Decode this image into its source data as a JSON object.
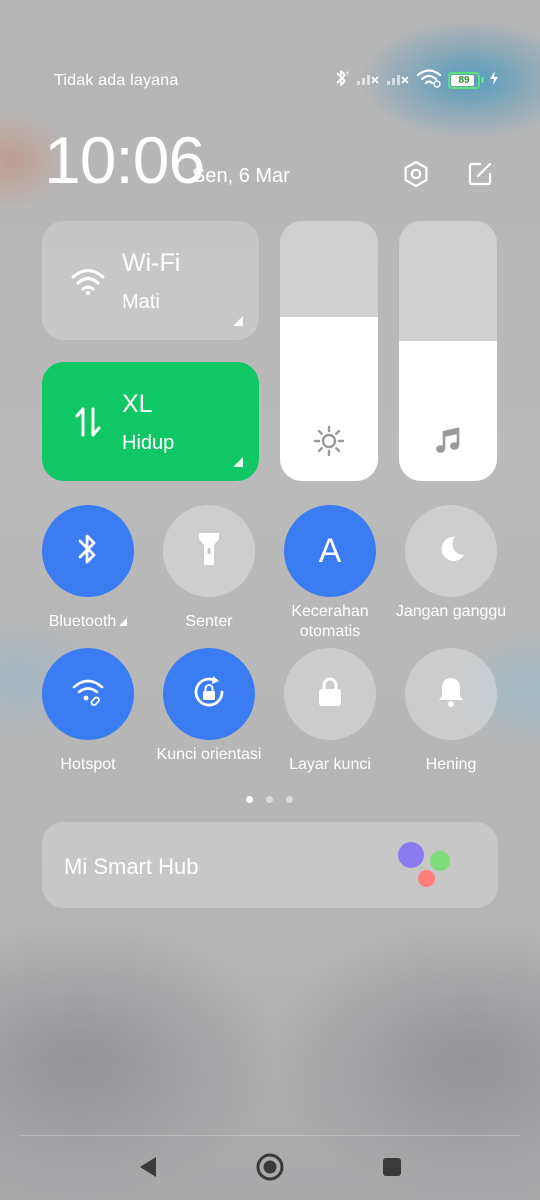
{
  "status_bar": {
    "carrier": "Tidak ada layana",
    "battery": "89",
    "battery_level": 0.89,
    "icons": [
      "bluetooth-icon",
      "signal-no-service-icon",
      "signal-no-service-icon",
      "wifi-icon",
      "battery-icon",
      "charging-icon"
    ]
  },
  "header": {
    "time": "10:06",
    "date": "Sen, 6 Mar",
    "icons": [
      "settings-icon",
      "edit-icon"
    ]
  },
  "tiles": {
    "wifi": {
      "title": "Wi-Fi",
      "status": "Mati",
      "icon": "wifi-icon"
    },
    "mobile_data": {
      "title": "XL",
      "status": "Hidup",
      "icon": "data-transfer-icon"
    }
  },
  "sliders": {
    "brightness": {
      "level": 0.63,
      "icon": "sun-icon"
    },
    "volume": {
      "level": 0.54,
      "icon": "music-note-icon"
    }
  },
  "toggles": [
    {
      "label": "Bluetooth",
      "state": "on",
      "icon": "bluetooth-icon"
    },
    {
      "label": "Senter",
      "state": "off",
      "icon": "flashlight-icon"
    },
    {
      "label": "Kecerahan otomatis",
      "state": "on",
      "icon": "auto-brightness-icon",
      "glyph": "A"
    },
    {
      "label": "Jangan ganggu",
      "state": "off",
      "icon": "moon-icon"
    },
    {
      "label": "Hotspot",
      "state": "on",
      "icon": "hotspot-icon"
    },
    {
      "label": "Kunci orientasi",
      "state": "on",
      "icon": "rotation-lock-icon"
    },
    {
      "label": "Layar kunci",
      "state": "off",
      "icon": "lock-icon"
    },
    {
      "label": "Hening",
      "state": "off",
      "icon": "bell-icon"
    }
  ],
  "pager": {
    "pages": 3,
    "current": 1
  },
  "smart_hub": {
    "label": "Mi Smart Hub",
    "colors": [
      "#8a7cf0",
      "#7fdc7a",
      "#ff7d7a"
    ]
  },
  "nav_bar": {
    "icons": [
      "back-icon",
      "home-icon",
      "recents-icon"
    ]
  },
  "colors": {
    "accent_on": "#3b7cf2",
    "data_green": "#0fc865",
    "battery_green": "#5ce07a"
  }
}
